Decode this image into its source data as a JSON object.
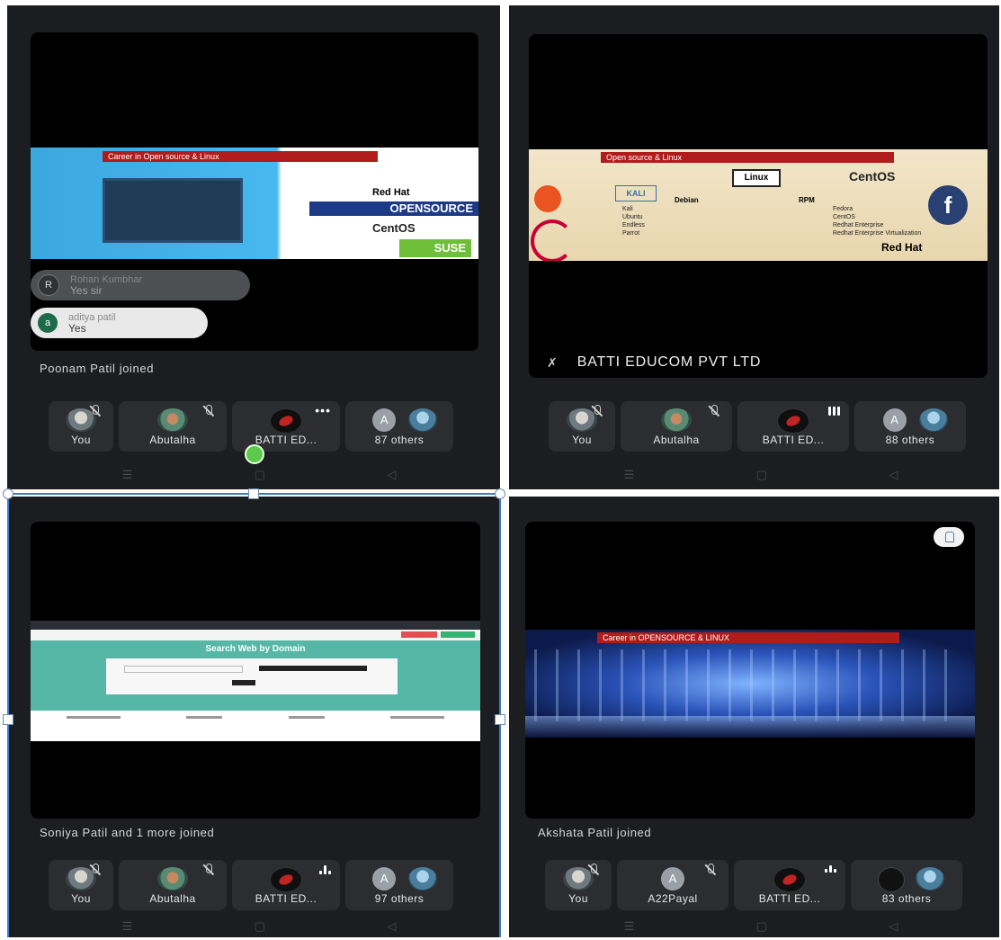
{
  "panels": [
    {
      "id": "top-left",
      "toast": "Poonam Patil joined",
      "slide": {
        "header": "Career in Open source & Linux",
        "logos": [
          "Red Hat",
          "OPENSOURCE",
          "CentOS",
          "SUSE"
        ]
      },
      "chat": [
        {
          "initial": "R",
          "name": "Rohan Kumbhar",
          "message": "Yes sir"
        },
        {
          "initial": "a",
          "name": "aditya patil",
          "message": "Yes"
        }
      ],
      "participants": [
        "You",
        "Abutalha",
        "BATTI ED...",
        "87 others"
      ],
      "others_letter": "A"
    },
    {
      "id": "top-right",
      "presenter": "BATTI EDUCOM PVT LTD",
      "slide": {
        "header": "Open source & Linux",
        "root": "Linux",
        "left_branch": "Debian",
        "left_items": [
          "Kali",
          "Ubuntu",
          "Endless",
          "Parrot"
        ],
        "right_branch": "RPM",
        "right_items": [
          "Fedora",
          "CentOS",
          "Redhat Enterprise",
          "Redhat Enterprise Virtualization"
        ],
        "logos": [
          "KALI",
          "CentOS",
          "Red Hat"
        ]
      },
      "participants": [
        "You",
        "Abutalha",
        "BATTI ED...",
        "88 others"
      ],
      "others_letter": "A"
    },
    {
      "id": "bottom-left",
      "toast": "Soniya Patil and 1 more joined",
      "screen": {
        "heading": "Search Web by Domain"
      },
      "participants": [
        "You",
        "Abutalha",
        "BATTI ED...",
        "97 others"
      ],
      "others_letter": "A"
    },
    {
      "id": "bottom-right",
      "toast": "Akshata Patil joined",
      "slide": {
        "header": "Career in OPENSOURCE & LINUX"
      },
      "participants": [
        "You",
        "A22Payal",
        "BATTI ED...",
        "83 others"
      ],
      "second_letter": "A"
    }
  ],
  "colors": {
    "panel_bg": "#1c1d20",
    "tile_bg": "#2c2d31",
    "accent_red": "#c8102e",
    "selection": "#3a7bd5"
  }
}
